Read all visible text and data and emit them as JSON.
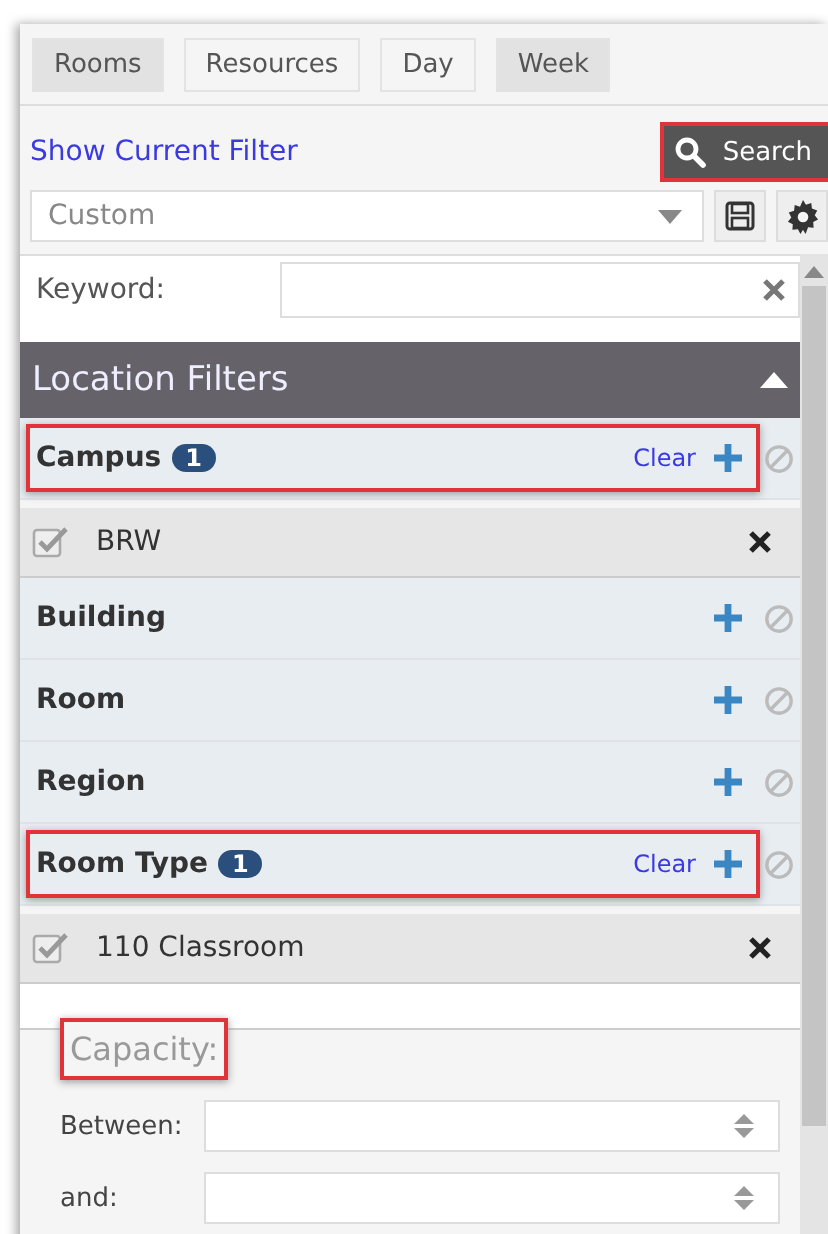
{
  "tabs": [
    {
      "label": "Rooms",
      "selected": true
    },
    {
      "label": "Resources",
      "selected": false
    },
    {
      "label": "Day",
      "selected": false
    },
    {
      "label": "Week",
      "selected": true
    }
  ],
  "filter_link": "Show Current Filter",
  "search_button": {
    "label": "Search",
    "highlighted": true
  },
  "saved_filter": {
    "value": "Custom"
  },
  "keyword": {
    "label": "Keyword:"
  },
  "section": {
    "title": "Location Filters",
    "expanded": true
  },
  "filters": [
    {
      "label": "Campus",
      "count": "1",
      "clear": "Clear",
      "highlighted": true,
      "selections": [
        {
          "label": "BRW",
          "checked": true
        }
      ]
    },
    {
      "label": "Building",
      "highlighted": false
    },
    {
      "label": "Room",
      "highlighted": false
    },
    {
      "label": "Region",
      "highlighted": false
    },
    {
      "label": "Room Type",
      "count": "1",
      "clear": "Clear",
      "highlighted": true,
      "selections": [
        {
          "label": "110 Classroom",
          "checked": true
        }
      ]
    }
  ],
  "capacity": {
    "legend": "Capacity:",
    "highlighted": true,
    "fields": [
      {
        "label": "Between:"
      },
      {
        "label": "and:"
      }
    ]
  }
}
